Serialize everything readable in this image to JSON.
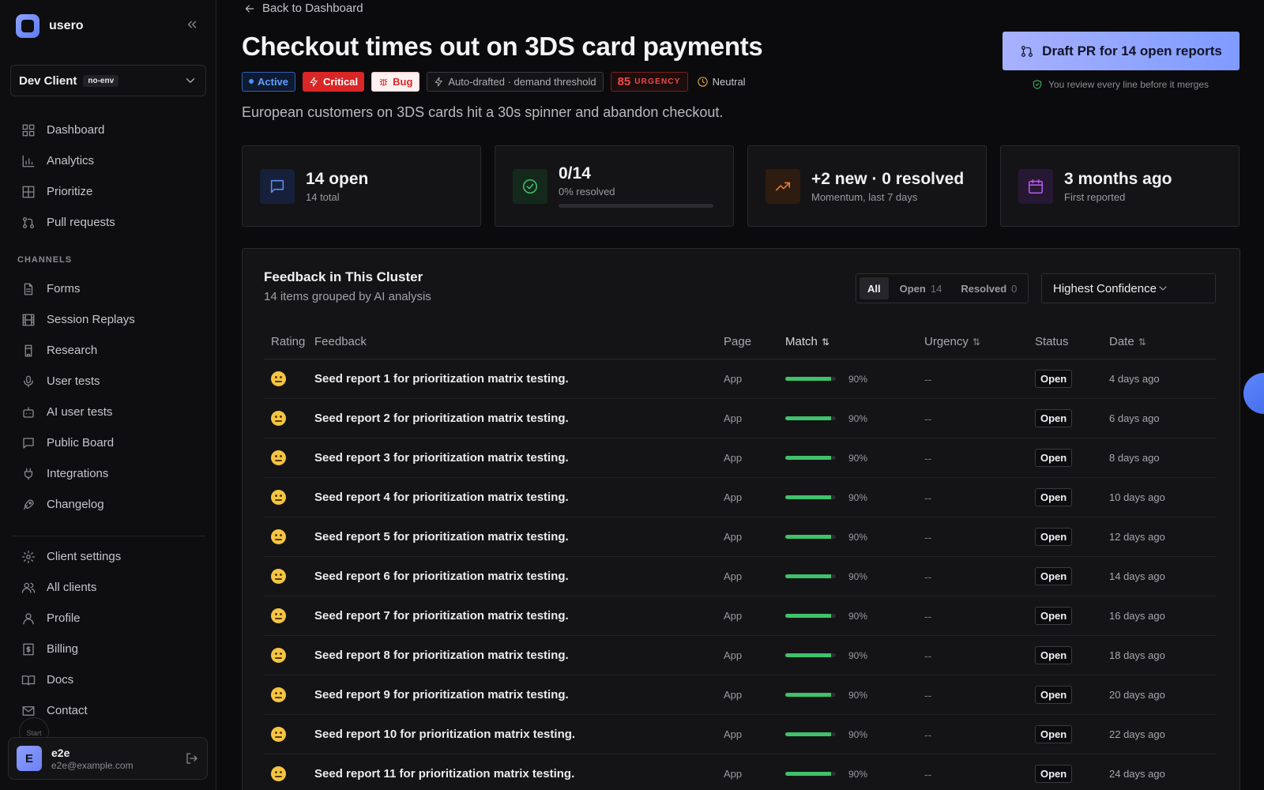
{
  "brand": {
    "name": "usero"
  },
  "client": {
    "name": "Dev Client",
    "env": "no-env"
  },
  "nav": {
    "main": [
      {
        "label": "Dashboard",
        "icon": "dashboard-icon"
      },
      {
        "label": "Analytics",
        "icon": "analytics-icon"
      },
      {
        "label": "Prioritize",
        "icon": "prioritize-icon"
      },
      {
        "label": "Pull requests",
        "icon": "pull-request-icon"
      }
    ],
    "section_label": "CHANNELS",
    "channels": [
      {
        "label": "Forms",
        "icon": "form-icon"
      },
      {
        "label": "Session Replays",
        "icon": "film-icon"
      },
      {
        "label": "Research",
        "icon": "research-icon"
      },
      {
        "label": "User tests",
        "icon": "mic-icon"
      },
      {
        "label": "AI user tests",
        "icon": "robot-icon"
      },
      {
        "label": "Public Board",
        "icon": "chat-icon"
      },
      {
        "label": "Integrations",
        "icon": "plug-icon"
      },
      {
        "label": "Changelog",
        "icon": "rocket-icon"
      }
    ],
    "settings": [
      {
        "label": "Client settings",
        "icon": "gear-icon"
      },
      {
        "label": "All clients",
        "icon": "users-icon"
      },
      {
        "label": "Profile",
        "icon": "user-icon"
      },
      {
        "label": "Billing",
        "icon": "billing-icon"
      },
      {
        "label": "Docs",
        "icon": "book-icon"
      },
      {
        "label": "Contact",
        "icon": "mail-icon"
      }
    ]
  },
  "start_label": "Start",
  "user": {
    "initial": "E",
    "name": "e2e",
    "email": "e2e@example.com"
  },
  "header": {
    "back_label": "Back to Dashboard",
    "title": "Checkout times out on 3DS card payments",
    "badges": {
      "active": "Active",
      "critical": "Critical",
      "bug": "Bug",
      "auto": "Auto-drafted · demand threshold",
      "urgency_value": "85",
      "urgency_label": "URGENCY",
      "sentiment": "Neutral"
    },
    "subtitle": "European customers on 3DS cards hit a 30s spinner and abandon checkout.",
    "draft_button": "Draft PR for 14 open reports",
    "review_note": "You review every line before it merges"
  },
  "stats": [
    {
      "value": "14 open",
      "label": "14 total",
      "icon": "message-icon",
      "color": "#4f7fe8"
    },
    {
      "value": "0/14",
      "label": "0% resolved",
      "icon": "check-circle-icon",
      "color": "#3fbf6a",
      "progress": 0
    },
    {
      "value": "+2 new · 0 resolved",
      "label": "Momentum, last 7 days",
      "icon": "trending-up-icon",
      "color": "#e8813a"
    },
    {
      "value": "3 months ago",
      "label": "First reported",
      "icon": "calendar-icon",
      "color": "#b45be8"
    }
  ],
  "panel": {
    "title": "Feedback in This Cluster",
    "subtitle": "14 items grouped by AI analysis",
    "filters": {
      "all": "All",
      "open": "Open",
      "open_count": "14",
      "resolved": "Resolved",
      "resolved_count": "0"
    },
    "sort": "Highest Confidence",
    "columns": [
      "Rating",
      "Feedback",
      "Page",
      "Match",
      "Urgency",
      "Status",
      "Date"
    ],
    "rows": [
      {
        "feedback": "Seed report 1 for prioritization matrix testing.",
        "page": "App",
        "match": "90%",
        "match_value": 0.9,
        "urgency": "--",
        "status": "Open",
        "date": "4 days ago"
      },
      {
        "feedback": "Seed report 2 for prioritization matrix testing.",
        "page": "App",
        "match": "90%",
        "match_value": 0.9,
        "urgency": "--",
        "status": "Open",
        "date": "6 days ago"
      },
      {
        "feedback": "Seed report 3 for prioritization matrix testing.",
        "page": "App",
        "match": "90%",
        "match_value": 0.9,
        "urgency": "--",
        "status": "Open",
        "date": "8 days ago"
      },
      {
        "feedback": "Seed report 4 for prioritization matrix testing.",
        "page": "App",
        "match": "90%",
        "match_value": 0.9,
        "urgency": "--",
        "status": "Open",
        "date": "10 days ago"
      },
      {
        "feedback": "Seed report 5 for prioritization matrix testing.",
        "page": "App",
        "match": "90%",
        "match_value": 0.9,
        "urgency": "--",
        "status": "Open",
        "date": "12 days ago"
      },
      {
        "feedback": "Seed report 6 for prioritization matrix testing.",
        "page": "App",
        "match": "90%",
        "match_value": 0.9,
        "urgency": "--",
        "status": "Open",
        "date": "14 days ago"
      },
      {
        "feedback": "Seed report 7 for prioritization matrix testing.",
        "page": "App",
        "match": "90%",
        "match_value": 0.9,
        "urgency": "--",
        "status": "Open",
        "date": "16 days ago"
      },
      {
        "feedback": "Seed report 8 for prioritization matrix testing.",
        "page": "App",
        "match": "90%",
        "match_value": 0.9,
        "urgency": "--",
        "status": "Open",
        "date": "18 days ago"
      },
      {
        "feedback": "Seed report 9 for prioritization matrix testing.",
        "page": "App",
        "match": "90%",
        "match_value": 0.9,
        "urgency": "--",
        "status": "Open",
        "date": "20 days ago"
      },
      {
        "feedback": "Seed report 10 for prioritization matrix testing.",
        "page": "App",
        "match": "90%",
        "match_value": 0.9,
        "urgency": "--",
        "status": "Open",
        "date": "22 days ago"
      },
      {
        "feedback": "Seed report 11 for prioritization matrix testing.",
        "page": "App",
        "match": "90%",
        "match_value": 0.9,
        "urgency": "--",
        "status": "Open",
        "date": "24 days ago"
      }
    ]
  }
}
